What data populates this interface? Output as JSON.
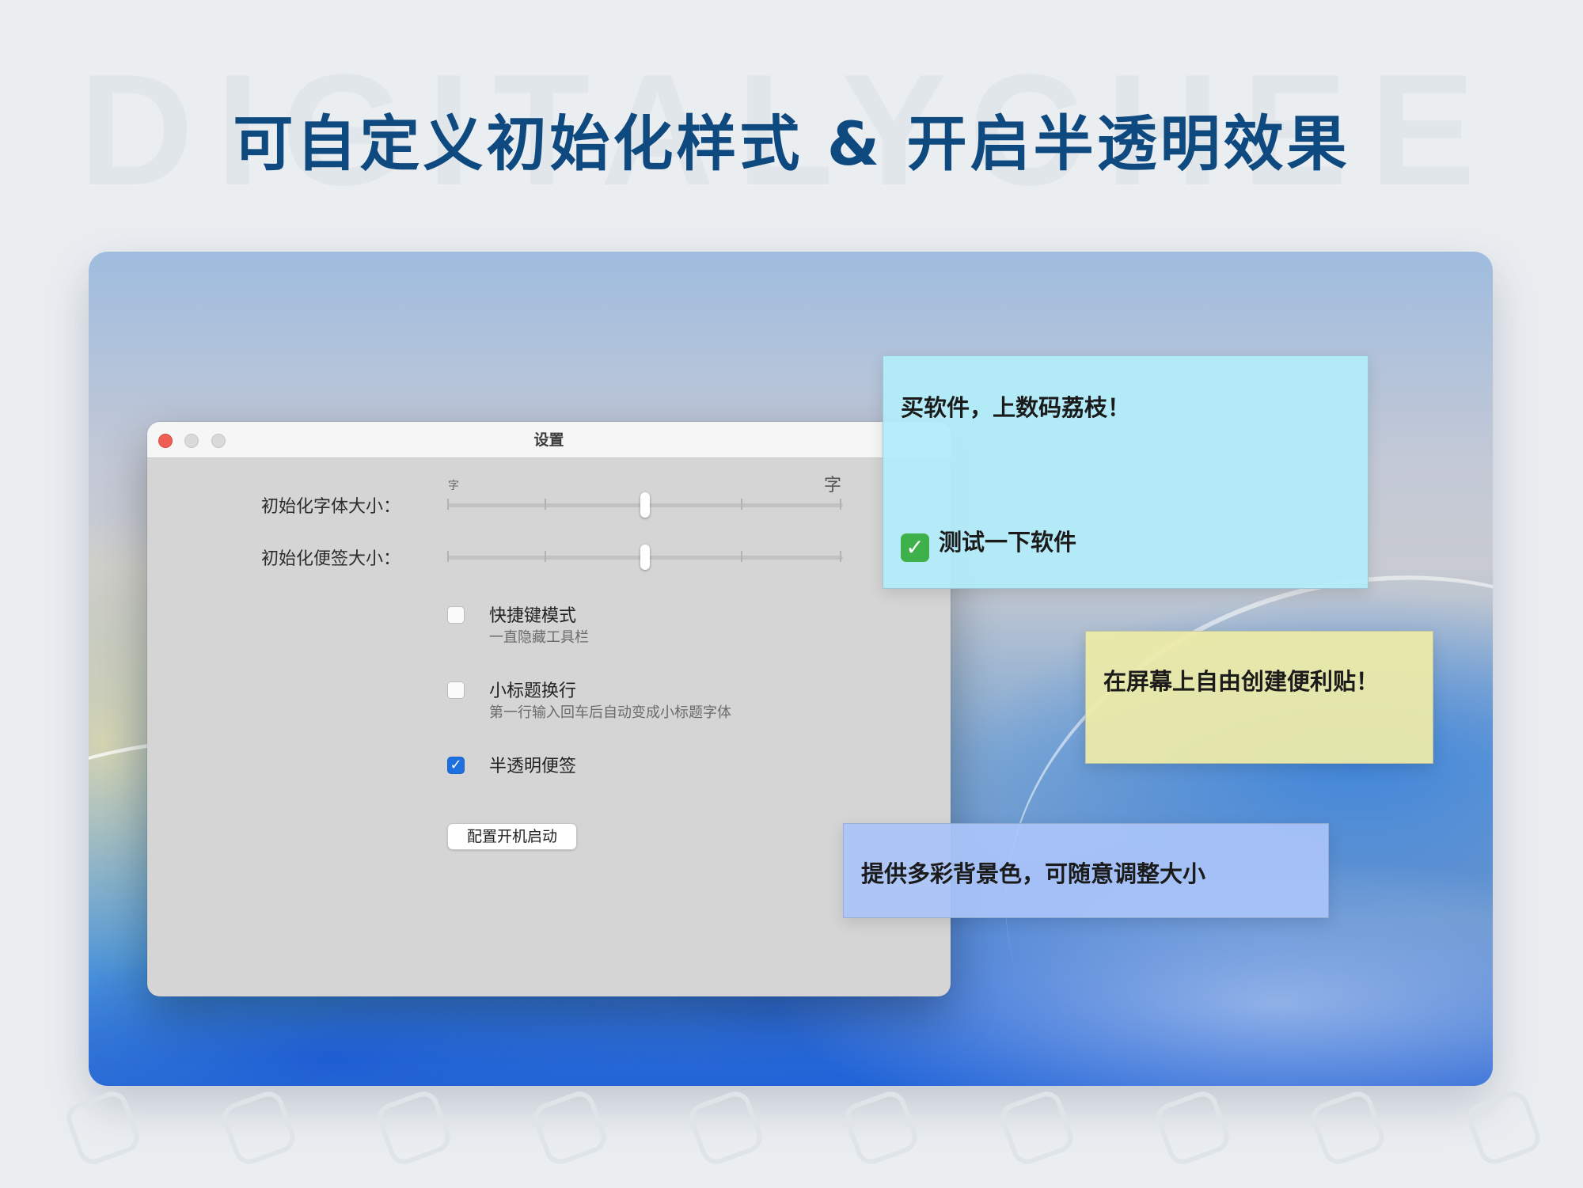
{
  "watermark": "DIGITALYCHEE",
  "headline": "可自定义初始化样式 & 开启半透明效果",
  "settings": {
    "window_title": "设置",
    "font_size_label": "初始化字体大小：",
    "note_size_label": "初始化便签大小：",
    "slider_small_mark": "字",
    "slider_large_mark": "字",
    "font_size_value": 0.5,
    "note_size_value": 0.5,
    "options": [
      {
        "label": "快捷键模式",
        "desc": "一直隐藏工具栏",
        "checked": false
      },
      {
        "label": "小标题换行",
        "desc": "第一行输入回车后自动变成小标题字体",
        "checked": false
      },
      {
        "label": "半透明便签",
        "desc": "",
        "checked": true
      }
    ],
    "launch_button": "配置开机启动"
  },
  "notes": {
    "cyan": {
      "line1": "买软件，上数码荔枝！",
      "todo": "测试一下软件",
      "color": "#b2ecfa"
    },
    "yellow": {
      "text": "在屏幕上自由创建便利贴！",
      "color": "#eeeca8"
    },
    "blue": {
      "text": "提供多彩背景色，可随意调整大小",
      "color": "#aac4f8"
    }
  },
  "colors": {
    "headline": "#0e4a7f",
    "checkbox_on": "#1e6fe0",
    "close_button": "#ef5e55"
  }
}
